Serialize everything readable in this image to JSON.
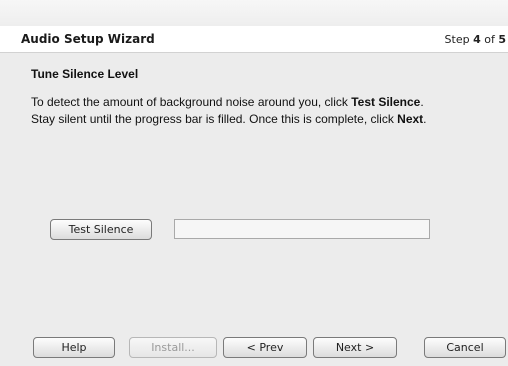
{
  "wizard": {
    "title": "Audio Setup Wizard",
    "step_prefix": "Step ",
    "step_current": "4",
    "step_of": " of ",
    "step_total": "5"
  },
  "section": {
    "title": "Tune Silence Level"
  },
  "description": {
    "line1_prefix": "To detect the amount of background noise around you, click ",
    "line1_bold": "Test Silence",
    "line1_suffix": ".",
    "line2_prefix": "Stay silent until the progress bar is filled. Once this is complete, click ",
    "line2_bold": "Next",
    "line2_suffix": "."
  },
  "test": {
    "button_label": "Test Silence",
    "progress_fraction": 0
  },
  "footer": {
    "help_label": "Help",
    "install_label": "Install...",
    "prev_label": "< Prev",
    "next_label": "Next >",
    "cancel_label": "Cancel"
  },
  "colors": {
    "content_bg": "#ececec",
    "progress_fill": "#4a90d9"
  }
}
